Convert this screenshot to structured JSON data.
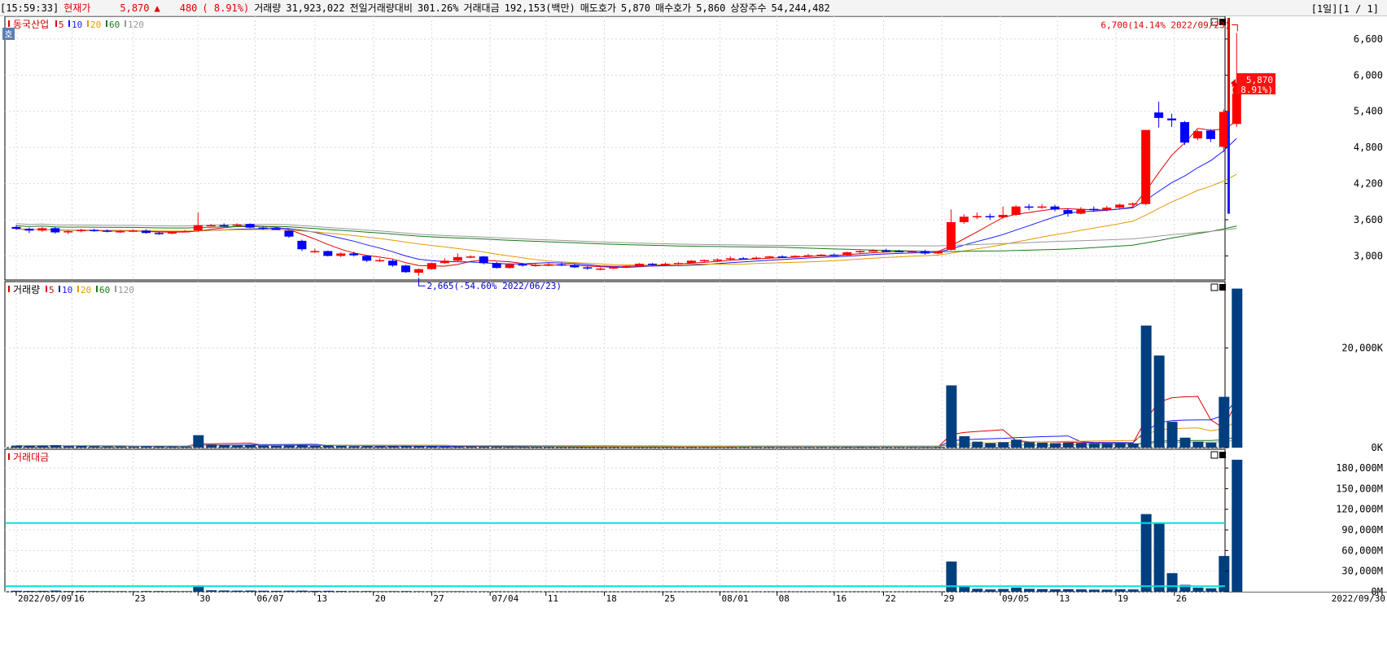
{
  "header": {
    "time": "[15:59:33]",
    "price_label": "현재가",
    "price": "5,870",
    "change_arrow": "▲",
    "change": "480",
    "change_pct": "( 8.91%)",
    "volume_label": "거래량",
    "volume": "31,923,022",
    "prev_ratio_label": "전일거래량대비",
    "prev_ratio": "301.26%",
    "amount_label": "거래대금",
    "amount": "192,153(백만)",
    "ask_label": "매도호가",
    "ask": "5,870",
    "bid_label": "매수호가",
    "bid": "5,860",
    "shares_label": "상장주수",
    "shares": "54,244,482",
    "page_info": "[1일][1 / 1]"
  },
  "price_panel": {
    "title": "동국산업",
    "ma_legend": [
      "5",
      "10",
      "20",
      "60",
      "120"
    ],
    "y_ticks": [
      "6,600",
      "6,000",
      "5,400",
      "4,800",
      "4,200",
      "3,600",
      "3,000"
    ],
    "current_price": "5,870",
    "current_pct": "( 8.91%)",
    "high_label": "6,700(14.14% 2022/09/23)",
    "low_label": "2,665(-54.60% 2022/06/23)",
    "badge": "호"
  },
  "volume_panel": {
    "title": "거래량",
    "ma_legend": [
      "5",
      "10",
      "20",
      "60",
      "120"
    ],
    "y_ticks": [
      "20,000K",
      "0K"
    ]
  },
  "amount_panel": {
    "title": "거래대금",
    "y_ticks": [
      "180,000M",
      "150,000M",
      "120,000M",
      "90,000M",
      "60,000M",
      "30,000M",
      "0M"
    ]
  },
  "x_axis": {
    "labels": [
      "2022/05/09",
      "16",
      "23",
      "30",
      "06/07",
      "13",
      "20",
      "27",
      "07/04",
      "11",
      "18",
      "25",
      "08/01",
      "08",
      "16",
      "22",
      "29",
      "09/05",
      "13",
      "19",
      "26",
      "2022/09/30"
    ]
  },
  "colors": {
    "up": "#ff0000",
    "down": "#0000ff",
    "ma5": "#e00000",
    "ma10": "#1a1aff",
    "ma20": "#e69a00",
    "ma60": "#1a7a1a",
    "ma120": "#999999",
    "bar": "#003f7f",
    "ref": "#00e0e0"
  },
  "chart_data": {
    "type": "candlestick",
    "unit_volume": "K",
    "unit_amount": "M",
    "y_range_price": [
      2600,
      6950
    ],
    "y_range_volume": [
      0,
      33000
    ],
    "y_range_amount": [
      0,
      205000
    ],
    "reference_lines_amount": [
      100000,
      8000
    ],
    "candles": [
      {
        "o": 3480,
        "h": 3510,
        "l": 3430,
        "c": 3450,
        "v": 400,
        "a": 1400
      },
      {
        "o": 3450,
        "h": 3470,
        "l": 3380,
        "c": 3420,
        "v": 350,
        "a": 1200
      },
      {
        "o": 3420,
        "h": 3480,
        "l": 3400,
        "c": 3460,
        "v": 380,
        "a": 1300
      },
      {
        "o": 3460,
        "h": 3480,
        "l": 3370,
        "c": 3390,
        "v": 500,
        "a": 1700
      },
      {
        "o": 3390,
        "h": 3430,
        "l": 3360,
        "c": 3410,
        "v": 300,
        "a": 1000
      },
      {
        "o": 3410,
        "h": 3450,
        "l": 3390,
        "c": 3430,
        "v": 320,
        "a": 1100
      },
      {
        "o": 3430,
        "h": 3450,
        "l": 3400,
        "c": 3420,
        "v": 280,
        "a": 960
      },
      {
        "o": 3420,
        "h": 3440,
        "l": 3390,
        "c": 3400,
        "v": 260,
        "a": 890
      },
      {
        "o": 3400,
        "h": 3430,
        "l": 3380,
        "c": 3410,
        "v": 250,
        "a": 850
      },
      {
        "o": 3410,
        "h": 3440,
        "l": 3400,
        "c": 3420,
        "v": 240,
        "a": 820
      },
      {
        "o": 3420,
        "h": 3440,
        "l": 3370,
        "c": 3380,
        "v": 300,
        "a": 1000
      },
      {
        "o": 3380,
        "h": 3400,
        "l": 3350,
        "c": 3370,
        "v": 280,
        "a": 950
      },
      {
        "o": 3370,
        "h": 3410,
        "l": 3360,
        "c": 3400,
        "v": 260,
        "a": 880
      },
      {
        "o": 3400,
        "h": 3430,
        "l": 3390,
        "c": 3410,
        "v": 240,
        "a": 820
      },
      {
        "o": 3420,
        "h": 3720,
        "l": 3400,
        "c": 3510,
        "v": 2500,
        "a": 9000
      },
      {
        "o": 3510,
        "h": 3530,
        "l": 3490,
        "c": 3510,
        "v": 600,
        "a": 2100
      },
      {
        "o": 3510,
        "h": 3540,
        "l": 3490,
        "c": 3500,
        "v": 500,
        "a": 1800
      },
      {
        "o": 3510,
        "h": 3540,
        "l": 3490,
        "c": 3520,
        "v": 450,
        "a": 1600
      },
      {
        "o": 3530,
        "h": 3540,
        "l": 3460,
        "c": 3470,
        "v": 500,
        "a": 1700
      },
      {
        "o": 3470,
        "h": 3490,
        "l": 3430,
        "c": 3450,
        "v": 420,
        "a": 1450
      },
      {
        "o": 3450,
        "h": 3470,
        "l": 3430,
        "c": 3440,
        "v": 380,
        "a": 1300
      },
      {
        "o": 3420,
        "h": 3430,
        "l": 3300,
        "c": 3320,
        "v": 450,
        "a": 1500
      },
      {
        "o": 3250,
        "h": 3270,
        "l": 3080,
        "c": 3110,
        "v": 500,
        "a": 1600
      },
      {
        "o": 3080,
        "h": 3120,
        "l": 3050,
        "c": 3080,
        "v": 400,
        "a": 1250
      },
      {
        "o": 3080,
        "h": 3090,
        "l": 2990,
        "c": 3000,
        "v": 450,
        "a": 1350
      },
      {
        "o": 3000,
        "h": 3060,
        "l": 2980,
        "c": 3040,
        "v": 350,
        "a": 1070
      },
      {
        "o": 3040,
        "h": 3070,
        "l": 2990,
        "c": 3010,
        "v": 300,
        "a": 900
      },
      {
        "o": 3000,
        "h": 3010,
        "l": 2900,
        "c": 2920,
        "v": 320,
        "a": 950
      },
      {
        "o": 2920,
        "h": 2960,
        "l": 2900,
        "c": 2930,
        "v": 260,
        "a": 760
      },
      {
        "o": 2920,
        "h": 2940,
        "l": 2820,
        "c": 2840,
        "v": 300,
        "a": 850
      },
      {
        "o": 2840,
        "h": 2850,
        "l": 2720,
        "c": 2730,
        "v": 350,
        "a": 950
      },
      {
        "o": 2720,
        "h": 2790,
        "l": 2665,
        "c": 2780,
        "v": 280,
        "a": 770
      },
      {
        "o": 2780,
        "h": 2890,
        "l": 2770,
        "c": 2880,
        "v": 260,
        "a": 730
      },
      {
        "o": 2880,
        "h": 2960,
        "l": 2870,
        "c": 2920,
        "v": 240,
        "a": 700
      },
      {
        "o": 2920,
        "h": 3040,
        "l": 2910,
        "c": 2980,
        "v": 260,
        "a": 770
      },
      {
        "o": 2980,
        "h": 3010,
        "l": 2960,
        "c": 2990,
        "v": 220,
        "a": 660
      },
      {
        "o": 2990,
        "h": 3000,
        "l": 2860,
        "c": 2880,
        "v": 230,
        "a": 670
      },
      {
        "o": 2880,
        "h": 2900,
        "l": 2790,
        "c": 2800,
        "v": 240,
        "a": 680
      },
      {
        "o": 2800,
        "h": 2880,
        "l": 2790,
        "c": 2860,
        "v": 200,
        "a": 560
      },
      {
        "o": 2860,
        "h": 2880,
        "l": 2820,
        "c": 2840,
        "v": 180,
        "a": 510
      },
      {
        "o": 2840,
        "h": 2870,
        "l": 2820,
        "c": 2850,
        "v": 170,
        "a": 490
      },
      {
        "o": 2850,
        "h": 2880,
        "l": 2830,
        "c": 2860,
        "v": 160,
        "a": 460
      },
      {
        "o": 2860,
        "h": 2890,
        "l": 2830,
        "c": 2850,
        "v": 150,
        "a": 430
      },
      {
        "o": 2850,
        "h": 2870,
        "l": 2800,
        "c": 2810,
        "v": 170,
        "a": 480
      },
      {
        "o": 2810,
        "h": 2830,
        "l": 2770,
        "c": 2790,
        "v": 160,
        "a": 450
      },
      {
        "o": 2790,
        "h": 2810,
        "l": 2760,
        "c": 2790,
        "v": 150,
        "a": 420
      },
      {
        "o": 2790,
        "h": 2830,
        "l": 2780,
        "c": 2820,
        "v": 140,
        "a": 400
      },
      {
        "o": 2820,
        "h": 2840,
        "l": 2800,
        "c": 2830,
        "v": 140,
        "a": 400
      },
      {
        "o": 2830,
        "h": 2880,
        "l": 2820,
        "c": 2870,
        "v": 150,
        "a": 430
      },
      {
        "o": 2870,
        "h": 2880,
        "l": 2840,
        "c": 2860,
        "v": 140,
        "a": 400
      },
      {
        "o": 2860,
        "h": 2890,
        "l": 2850,
        "c": 2870,
        "v": 140,
        "a": 400
      },
      {
        "o": 2870,
        "h": 2900,
        "l": 2850,
        "c": 2880,
        "v": 140,
        "a": 400
      },
      {
        "o": 2880,
        "h": 2930,
        "l": 2870,
        "c": 2920,
        "v": 150,
        "a": 440
      },
      {
        "o": 2920,
        "h": 2940,
        "l": 2900,
        "c": 2930,
        "v": 140,
        "a": 410
      },
      {
        "o": 2930,
        "h": 2960,
        "l": 2910,
        "c": 2940,
        "v": 140,
        "a": 410
      },
      {
        "o": 2940,
        "h": 2990,
        "l": 2930,
        "c": 2960,
        "v": 150,
        "a": 450
      },
      {
        "o": 2960,
        "h": 2980,
        "l": 2940,
        "c": 2950,
        "v": 140,
        "a": 420
      },
      {
        "o": 2950,
        "h": 2990,
        "l": 2940,
        "c": 2970,
        "v": 140,
        "a": 420
      },
      {
        "o": 2970,
        "h": 3000,
        "l": 2960,
        "c": 2990,
        "v": 140,
        "a": 420
      },
      {
        "o": 2990,
        "h": 3010,
        "l": 2970,
        "c": 2980,
        "v": 130,
        "a": 390
      },
      {
        "o": 2980,
        "h": 3010,
        "l": 2970,
        "c": 3000,
        "v": 130,
        "a": 390
      },
      {
        "o": 3000,
        "h": 3030,
        "l": 2980,
        "c": 3010,
        "v": 130,
        "a": 390
      },
      {
        "o": 3010,
        "h": 3030,
        "l": 3000,
        "c": 3020,
        "v": 130,
        "a": 390
      },
      {
        "o": 3020,
        "h": 3040,
        "l": 3000,
        "c": 3010,
        "v": 130,
        "a": 390
      },
      {
        "o": 3010,
        "h": 3070,
        "l": 3000,
        "c": 3060,
        "v": 150,
        "a": 460
      },
      {
        "o": 3060,
        "h": 3090,
        "l": 3040,
        "c": 3080,
        "v": 150,
        "a": 460
      },
      {
        "o": 3080,
        "h": 3110,
        "l": 3070,
        "c": 3090,
        "v": 150,
        "a": 460
      },
      {
        "o": 3090,
        "h": 3120,
        "l": 3070,
        "c": 3080,
        "v": 140,
        "a": 430
      },
      {
        "o": 3080,
        "h": 3100,
        "l": 3060,
        "c": 3070,
        "v": 130,
        "a": 400
      },
      {
        "o": 3070,
        "h": 3090,
        "l": 3050,
        "c": 3080,
        "v": 130,
        "a": 400
      },
      {
        "o": 3080,
        "h": 3100,
        "l": 3020,
        "c": 3040,
        "v": 140,
        "a": 430
      },
      {
        "o": 3040,
        "h": 3090,
        "l": 3030,
        "c": 3080,
        "v": 150,
        "a": 460
      },
      {
        "o": 3100,
        "h": 3770,
        "l": 3090,
        "c": 3560,
        "v": 12500,
        "a": 44000
      },
      {
        "o": 3560,
        "h": 3690,
        "l": 3530,
        "c": 3650,
        "v": 2300,
        "a": 8300
      },
      {
        "o": 3650,
        "h": 3720,
        "l": 3610,
        "c": 3660,
        "v": 1200,
        "a": 4300
      },
      {
        "o": 3660,
        "h": 3700,
        "l": 3600,
        "c": 3640,
        "v": 900,
        "a": 3300
      },
      {
        "o": 3640,
        "h": 3820,
        "l": 3620,
        "c": 3680,
        "v": 1100,
        "a": 4000
      },
      {
        "o": 3680,
        "h": 3840,
        "l": 3660,
        "c": 3820,
        "v": 1600,
        "a": 6000
      },
      {
        "o": 3820,
        "h": 3860,
        "l": 3760,
        "c": 3800,
        "v": 1100,
        "a": 4200
      },
      {
        "o": 3800,
        "h": 3860,
        "l": 3780,
        "c": 3820,
        "v": 1000,
        "a": 3800
      },
      {
        "o": 3820,
        "h": 3850,
        "l": 3740,
        "c": 3770,
        "v": 900,
        "a": 3400
      },
      {
        "o": 3760,
        "h": 3790,
        "l": 3650,
        "c": 3700,
        "v": 1000,
        "a": 3700
      },
      {
        "o": 3700,
        "h": 3810,
        "l": 3690,
        "c": 3780,
        "v": 900,
        "a": 3400
      },
      {
        "o": 3780,
        "h": 3820,
        "l": 3730,
        "c": 3760,
        "v": 800,
        "a": 3000
      },
      {
        "o": 3760,
        "h": 3830,
        "l": 3740,
        "c": 3800,
        "v": 800,
        "a": 3000
      },
      {
        "o": 3800,
        "h": 3870,
        "l": 3780,
        "c": 3850,
        "v": 900,
        "a": 3500
      },
      {
        "o": 3850,
        "h": 3890,
        "l": 3820,
        "c": 3870,
        "v": 850,
        "a": 3300
      },
      {
        "o": 3860,
        "h": 5090,
        "l": 3840,
        "c": 5090,
        "v": 24500,
        "a": 113000
      },
      {
        "o": 5380,
        "h": 5560,
        "l": 5130,
        "c": 5290,
        "v": 18500,
        "a": 99000
      },
      {
        "o": 5280,
        "h": 5360,
        "l": 5140,
        "c": 5250,
        "v": 5200,
        "a": 27000
      },
      {
        "o": 5220,
        "h": 5240,
        "l": 4840,
        "c": 4880,
        "v": 2000,
        "a": 10000
      },
      {
        "o": 4950,
        "h": 5090,
        "l": 4920,
        "c": 5070,
        "v": 1200,
        "a": 6000
      },
      {
        "o": 5080,
        "h": 5100,
        "l": 4890,
        "c": 4940,
        "v": 1000,
        "a": 5000
      },
      {
        "o": 4810,
        "h": 5430,
        "l": 4720,
        "c": 5390,
        "v": 10200,
        "a": 52000
      },
      {
        "o": 5190,
        "h": 6700,
        "l": 5140,
        "c": 5870,
        "v": 31923,
        "a": 192153
      }
    ]
  }
}
